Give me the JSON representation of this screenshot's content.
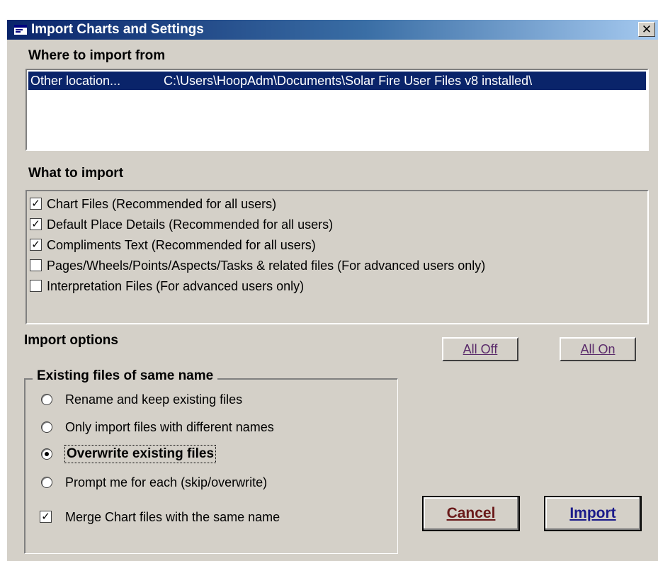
{
  "window": {
    "title": "Import Charts and Settings",
    "close_glyph": "✕"
  },
  "where_section": {
    "heading": "Where to import from",
    "rows": [
      {
        "name": "Other location...",
        "path": "C:\\Users\\HoopAdm\\Documents\\Solar Fire User Files v8 installed\\",
        "selected": true
      }
    ]
  },
  "what_section": {
    "heading": "What to import",
    "items": [
      {
        "label": "Chart Files (Recommended for all users)",
        "checked": true
      },
      {
        "label": "Default Place Details (Recommended for all users)",
        "checked": true
      },
      {
        "label": "Compliments Text (Recommended for all users)",
        "checked": true
      },
      {
        "label": "Pages/Wheels/Points/Aspects/Tasks & related files (For advanced users only)",
        "checked": false
      },
      {
        "label": "Interpretation Files (For advanced users only)",
        "checked": false
      }
    ]
  },
  "options": {
    "heading": "Import options",
    "all_off": "All Off",
    "all_on": "All On",
    "group_title": "Existing files of same name",
    "radios": [
      {
        "label": "Rename and keep existing files",
        "selected": false
      },
      {
        "label": "Only import files with different names",
        "selected": false
      },
      {
        "label": "Overwrite existing files",
        "selected": true
      },
      {
        "label": "Prompt me for each (skip/overwrite)",
        "selected": false
      }
    ],
    "merge_label": "Merge Chart files with the same name",
    "merge_checked": true
  },
  "buttons": {
    "cancel": "Cancel",
    "import": "Import"
  },
  "colors": {
    "titlebar_start": "#0a246a",
    "selection": "#0a246a",
    "dialog_bg": "#d4d0c8"
  }
}
